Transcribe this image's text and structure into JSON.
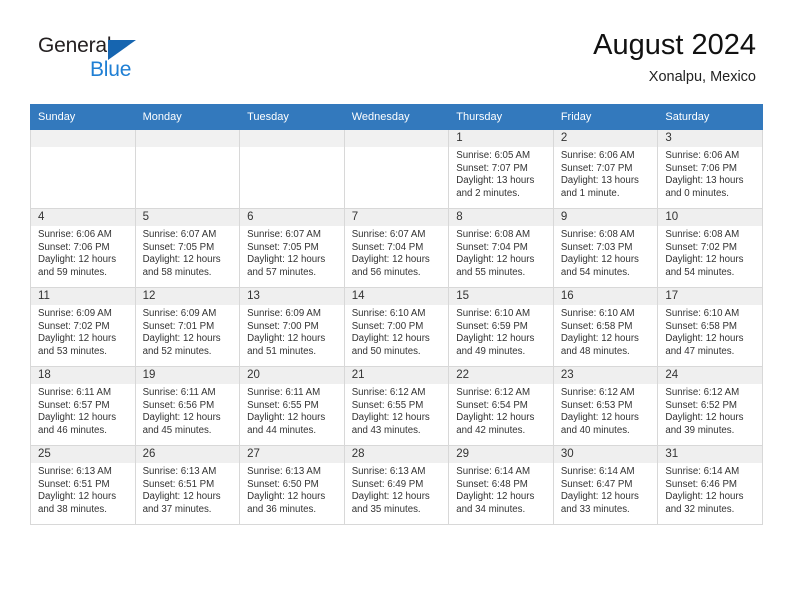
{
  "brand": {
    "name_top": "General",
    "name_bottom": "Blue",
    "accent_blue": "#1f7fd4",
    "triangle_blue": "#1665b0"
  },
  "header": {
    "title": "August 2024",
    "subtitle": "Xonalpu, Mexico",
    "header_bg": "#3379bd"
  },
  "weekday_headers": [
    "Sunday",
    "Monday",
    "Tuesday",
    "Wednesday",
    "Thursday",
    "Friday",
    "Saturday"
  ],
  "labels": {
    "sunrise": "Sunrise:",
    "sunset": "Sunset:",
    "daylight": "Daylight:"
  },
  "weeks": [
    [
      {
        "day": "",
        "empty": true
      },
      {
        "day": "",
        "empty": true
      },
      {
        "day": "",
        "empty": true
      },
      {
        "day": "",
        "empty": true
      },
      {
        "day": "1",
        "sunrise": "Sunrise: 6:05 AM",
        "sunset": "Sunset: 7:07 PM",
        "daylight_1": "Daylight: 13 hours",
        "daylight_2": "and 2 minutes."
      },
      {
        "day": "2",
        "sunrise": "Sunrise: 6:06 AM",
        "sunset": "Sunset: 7:07 PM",
        "daylight_1": "Daylight: 13 hours",
        "daylight_2": "and 1 minute."
      },
      {
        "day": "3",
        "sunrise": "Sunrise: 6:06 AM",
        "sunset": "Sunset: 7:06 PM",
        "daylight_1": "Daylight: 13 hours",
        "daylight_2": "and 0 minutes."
      }
    ],
    [
      {
        "day": "4",
        "sunrise": "Sunrise: 6:06 AM",
        "sunset": "Sunset: 7:06 PM",
        "daylight_1": "Daylight: 12 hours",
        "daylight_2": "and 59 minutes."
      },
      {
        "day": "5",
        "sunrise": "Sunrise: 6:07 AM",
        "sunset": "Sunset: 7:05 PM",
        "daylight_1": "Daylight: 12 hours",
        "daylight_2": "and 58 minutes."
      },
      {
        "day": "6",
        "sunrise": "Sunrise: 6:07 AM",
        "sunset": "Sunset: 7:05 PM",
        "daylight_1": "Daylight: 12 hours",
        "daylight_2": "and 57 minutes."
      },
      {
        "day": "7",
        "sunrise": "Sunrise: 6:07 AM",
        "sunset": "Sunset: 7:04 PM",
        "daylight_1": "Daylight: 12 hours",
        "daylight_2": "and 56 minutes."
      },
      {
        "day": "8",
        "sunrise": "Sunrise: 6:08 AM",
        "sunset": "Sunset: 7:04 PM",
        "daylight_1": "Daylight: 12 hours",
        "daylight_2": "and 55 minutes."
      },
      {
        "day": "9",
        "sunrise": "Sunrise: 6:08 AM",
        "sunset": "Sunset: 7:03 PM",
        "daylight_1": "Daylight: 12 hours",
        "daylight_2": "and 54 minutes."
      },
      {
        "day": "10",
        "sunrise": "Sunrise: 6:08 AM",
        "sunset": "Sunset: 7:02 PM",
        "daylight_1": "Daylight: 12 hours",
        "daylight_2": "and 54 minutes."
      }
    ],
    [
      {
        "day": "11",
        "sunrise": "Sunrise: 6:09 AM",
        "sunset": "Sunset: 7:02 PM",
        "daylight_1": "Daylight: 12 hours",
        "daylight_2": "and 53 minutes."
      },
      {
        "day": "12",
        "sunrise": "Sunrise: 6:09 AM",
        "sunset": "Sunset: 7:01 PM",
        "daylight_1": "Daylight: 12 hours",
        "daylight_2": "and 52 minutes."
      },
      {
        "day": "13",
        "sunrise": "Sunrise: 6:09 AM",
        "sunset": "Sunset: 7:00 PM",
        "daylight_1": "Daylight: 12 hours",
        "daylight_2": "and 51 minutes."
      },
      {
        "day": "14",
        "sunrise": "Sunrise: 6:10 AM",
        "sunset": "Sunset: 7:00 PM",
        "daylight_1": "Daylight: 12 hours",
        "daylight_2": "and 50 minutes."
      },
      {
        "day": "15",
        "sunrise": "Sunrise: 6:10 AM",
        "sunset": "Sunset: 6:59 PM",
        "daylight_1": "Daylight: 12 hours",
        "daylight_2": "and 49 minutes."
      },
      {
        "day": "16",
        "sunrise": "Sunrise: 6:10 AM",
        "sunset": "Sunset: 6:58 PM",
        "daylight_1": "Daylight: 12 hours",
        "daylight_2": "and 48 minutes."
      },
      {
        "day": "17",
        "sunrise": "Sunrise: 6:10 AM",
        "sunset": "Sunset: 6:58 PM",
        "daylight_1": "Daylight: 12 hours",
        "daylight_2": "and 47 minutes."
      }
    ],
    [
      {
        "day": "18",
        "sunrise": "Sunrise: 6:11 AM",
        "sunset": "Sunset: 6:57 PM",
        "daylight_1": "Daylight: 12 hours",
        "daylight_2": "and 46 minutes."
      },
      {
        "day": "19",
        "sunrise": "Sunrise: 6:11 AM",
        "sunset": "Sunset: 6:56 PM",
        "daylight_1": "Daylight: 12 hours",
        "daylight_2": "and 45 minutes."
      },
      {
        "day": "20",
        "sunrise": "Sunrise: 6:11 AM",
        "sunset": "Sunset: 6:55 PM",
        "daylight_1": "Daylight: 12 hours",
        "daylight_2": "and 44 minutes."
      },
      {
        "day": "21",
        "sunrise": "Sunrise: 6:12 AM",
        "sunset": "Sunset: 6:55 PM",
        "daylight_1": "Daylight: 12 hours",
        "daylight_2": "and 43 minutes."
      },
      {
        "day": "22",
        "sunrise": "Sunrise: 6:12 AM",
        "sunset": "Sunset: 6:54 PM",
        "daylight_1": "Daylight: 12 hours",
        "daylight_2": "and 42 minutes."
      },
      {
        "day": "23",
        "sunrise": "Sunrise: 6:12 AM",
        "sunset": "Sunset: 6:53 PM",
        "daylight_1": "Daylight: 12 hours",
        "daylight_2": "and 40 minutes."
      },
      {
        "day": "24",
        "sunrise": "Sunrise: 6:12 AM",
        "sunset": "Sunset: 6:52 PM",
        "daylight_1": "Daylight: 12 hours",
        "daylight_2": "and 39 minutes."
      }
    ],
    [
      {
        "day": "25",
        "sunrise": "Sunrise: 6:13 AM",
        "sunset": "Sunset: 6:51 PM",
        "daylight_1": "Daylight: 12 hours",
        "daylight_2": "and 38 minutes."
      },
      {
        "day": "26",
        "sunrise": "Sunrise: 6:13 AM",
        "sunset": "Sunset: 6:51 PM",
        "daylight_1": "Daylight: 12 hours",
        "daylight_2": "and 37 minutes."
      },
      {
        "day": "27",
        "sunrise": "Sunrise: 6:13 AM",
        "sunset": "Sunset: 6:50 PM",
        "daylight_1": "Daylight: 12 hours",
        "daylight_2": "and 36 minutes."
      },
      {
        "day": "28",
        "sunrise": "Sunrise: 6:13 AM",
        "sunset": "Sunset: 6:49 PM",
        "daylight_1": "Daylight: 12 hours",
        "daylight_2": "and 35 minutes."
      },
      {
        "day": "29",
        "sunrise": "Sunrise: 6:14 AM",
        "sunset": "Sunset: 6:48 PM",
        "daylight_1": "Daylight: 12 hours",
        "daylight_2": "and 34 minutes."
      },
      {
        "day": "30",
        "sunrise": "Sunrise: 6:14 AM",
        "sunset": "Sunset: 6:47 PM",
        "daylight_1": "Daylight: 12 hours",
        "daylight_2": "and 33 minutes."
      },
      {
        "day": "31",
        "sunrise": "Sunrise: 6:14 AM",
        "sunset": "Sunset: 6:46 PM",
        "daylight_1": "Daylight: 12 hours",
        "daylight_2": "and 32 minutes."
      }
    ]
  ]
}
